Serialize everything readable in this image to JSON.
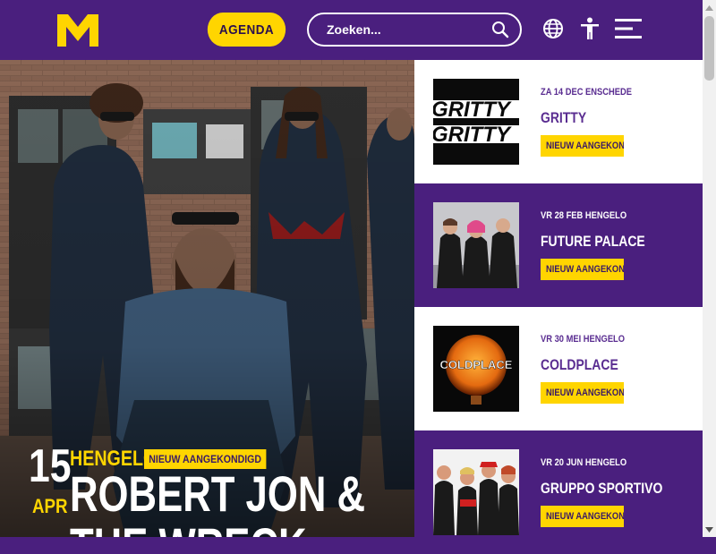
{
  "header": {
    "agenda_label": "AGENDA",
    "search_placeholder": "Zoeken...",
    "icons": [
      "logo-icon",
      "search-icon",
      "globe-icon",
      "accessibility-icon",
      "menu-icon"
    ],
    "colors": {
      "brand_purple": "#4a1f7e",
      "accent_yellow": "#ffd500"
    }
  },
  "hero": {
    "day": "15",
    "month": "APR",
    "city": "HENGELO",
    "badge": "NIEUW AANGEKONDIGD",
    "title": "ROBERT JON & THE WRECK"
  },
  "events": [
    {
      "meta": "ZA 14 DEC ENSCHEDE",
      "title": "GRITTY",
      "badge": "NIEUW AANGEKONDIGD",
      "thumb_text": "GRITTY"
    },
    {
      "meta": "VR 28 FEB HENGELO",
      "title": "FUTURE PALACE",
      "badge": "NIEUW AANGEKONDIGD"
    },
    {
      "meta": "VR 30 MEI HENGELO",
      "title": "COLDPLACE",
      "badge": "NIEUW AANGEKONDIGD",
      "thumb_text": "COLDPLACE"
    },
    {
      "meta": "VR 20 JUN HENGELO",
      "title": "GRUPPO SPORTIVO",
      "badge": "NIEUW AANGEKONDIGD"
    }
  ]
}
